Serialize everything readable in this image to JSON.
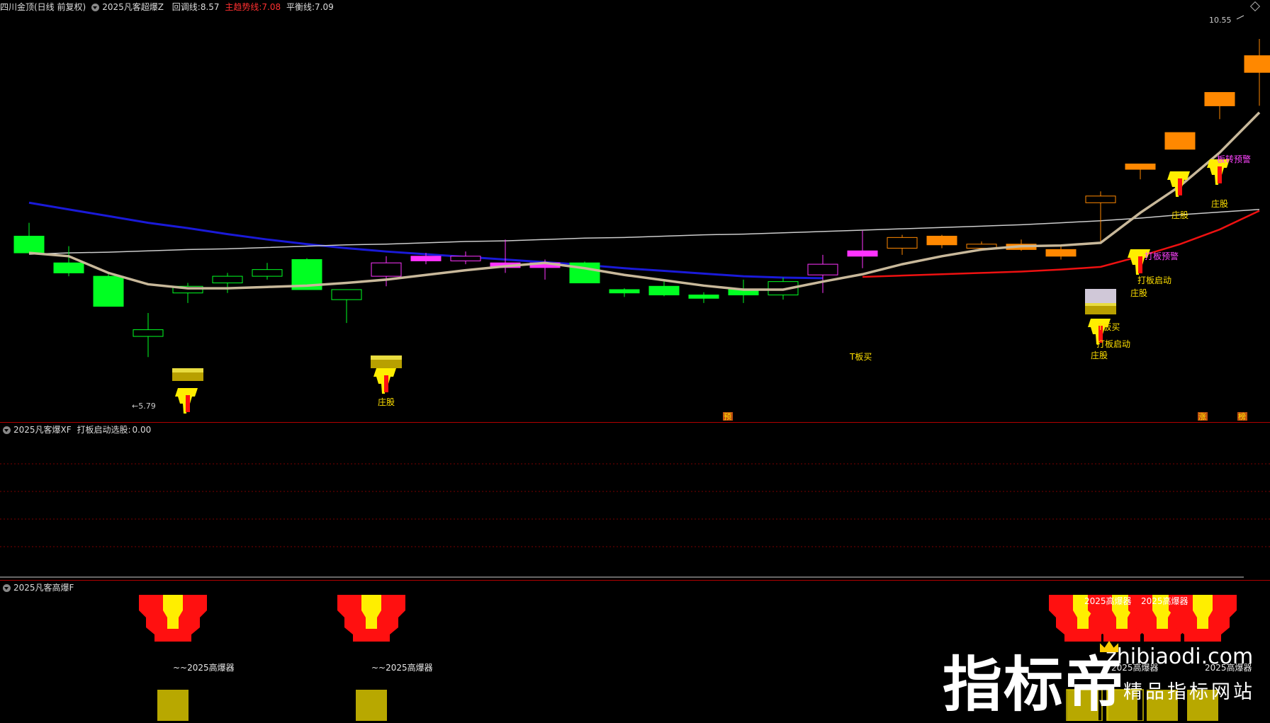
{
  "header": {
    "stock": "四川金顶(日线 前复权)",
    "indicator": "2025凡客超爆Z",
    "pullback_label": "回调线:",
    "pullback_value": "8.57",
    "trend_label": "主趋势线:",
    "trend_value": "7.08",
    "balance_label": "平衡线:",
    "balance_value": "7.09"
  },
  "colors": {
    "up": "#ff8800",
    "down": "#00ff22",
    "magenta": "#ff33ff",
    "trend": "#ee1111",
    "balance": "#cccccc",
    "pullback": "#c8b89a",
    "long_ma": "#1a1ad8",
    "separator": "#b00000"
  },
  "chart_data": [
    {
      "type": "candlestick",
      "title": "四川金顶(日线 前复权)",
      "price_range": [
        5.2,
        10.9
      ],
      "high_label": "10.55",
      "low_label": "5.79",
      "candles": [
        {
          "o": 7.6,
          "h": 7.8,
          "l": 7.4,
          "c": 7.35,
          "color": "green"
        },
        {
          "o": 7.2,
          "h": 7.45,
          "l": 7.0,
          "c": 7.05,
          "color": "green"
        },
        {
          "o": 7.0,
          "h": 7.05,
          "l": 6.55,
          "c": 6.55,
          "color": "green"
        },
        {
          "o": 6.2,
          "h": 6.45,
          "l": 5.79,
          "c": 6.1,
          "color": "green-hollow"
        },
        {
          "o": 6.85,
          "h": 6.9,
          "l": 6.6,
          "c": 6.75,
          "color": "green-hollow"
        },
        {
          "o": 7.0,
          "h": 7.05,
          "l": 6.75,
          "c": 6.9,
          "color": "green-hollow"
        },
        {
          "o": 7.1,
          "h": 7.2,
          "l": 6.95,
          "c": 7.0,
          "color": "green-hollow"
        },
        {
          "o": 7.25,
          "h": 7.27,
          "l": 6.8,
          "c": 6.8,
          "color": "green"
        },
        {
          "o": 6.65,
          "h": 6.8,
          "l": 6.3,
          "c": 6.8,
          "color": "green-hollow"
        },
        {
          "o": 7.2,
          "h": 7.3,
          "l": 6.85,
          "c": 7.0,
          "color": "magenta-hollow"
        },
        {
          "o": 7.3,
          "h": 7.35,
          "l": 7.18,
          "c": 7.23,
          "color": "magenta"
        },
        {
          "o": 7.3,
          "h": 7.37,
          "l": 7.18,
          "c": 7.23,
          "color": "magenta-hollow"
        },
        {
          "o": 7.2,
          "h": 7.55,
          "l": 7.05,
          "c": 7.13,
          "color": "magenta"
        },
        {
          "o": 7.2,
          "h": 7.25,
          "l": 6.95,
          "c": 7.13,
          "color": "magenta"
        },
        {
          "o": 7.2,
          "h": 7.22,
          "l": 6.9,
          "c": 6.9,
          "color": "green"
        },
        {
          "o": 6.8,
          "h": 6.82,
          "l": 6.69,
          "c": 6.75,
          "color": "green"
        },
        {
          "o": 6.85,
          "h": 6.95,
          "l": 6.7,
          "c": 6.72,
          "color": "green"
        },
        {
          "o": 6.72,
          "h": 6.76,
          "l": 6.6,
          "c": 6.67,
          "color": "green"
        },
        {
          "o": 6.8,
          "h": 6.95,
          "l": 6.6,
          "c": 6.72,
          "color": "green"
        },
        {
          "o": 6.72,
          "h": 6.98,
          "l": 6.65,
          "c": 6.92,
          "color": "green-hollow"
        },
        {
          "o": 7.02,
          "h": 7.32,
          "l": 6.75,
          "c": 7.18,
          "color": "magenta-hollow"
        },
        {
          "o": 7.3,
          "h": 7.68,
          "l": 7.12,
          "c": 7.38,
          "color": "magenta"
        },
        {
          "o": 7.42,
          "h": 7.62,
          "l": 7.32,
          "c": 7.58,
          "color": "orange-hollow"
        },
        {
          "o": 7.47,
          "h": 7.62,
          "l": 7.42,
          "c": 7.6,
          "color": "orange"
        },
        {
          "o": 7.42,
          "h": 7.52,
          "l": 7.38,
          "c": 7.48,
          "color": "orange-hollow"
        },
        {
          "o": 7.4,
          "h": 7.55,
          "l": 7.38,
          "c": 7.48,
          "color": "orange"
        },
        {
          "o": 7.3,
          "h": 7.45,
          "l": 7.25,
          "c": 7.4,
          "color": "orange"
        },
        {
          "o": 8.1,
          "h": 8.27,
          "l": 7.5,
          "c": 8.2,
          "color": "orange-hollow"
        },
        {
          "o": 8.6,
          "h": 8.68,
          "l": 8.45,
          "c": 8.68,
          "color": "orange"
        },
        {
          "o": 8.9,
          "h": 9.15,
          "l": 8.9,
          "c": 9.15,
          "color": "orange"
        },
        {
          "o": 9.55,
          "h": 9.75,
          "l": 9.35,
          "c": 9.75,
          "color": "orange"
        },
        {
          "o": 10.05,
          "h": 10.55,
          "l": 9.55,
          "c": 10.3,
          "color": "orange"
        }
      ],
      "series": [
        {
          "name": "回调线",
          "values": [
            7.35,
            7.3,
            7.05,
            6.88,
            6.82,
            6.82,
            6.84,
            6.86,
            6.9,
            6.95,
            7.02,
            7.09,
            7.15,
            7.2,
            7.12,
            7.02,
            6.94,
            6.86,
            6.8,
            6.8,
            6.92,
            7.03,
            7.18,
            7.3,
            7.4,
            7.45,
            7.46,
            7.5,
            7.95,
            8.35,
            8.85,
            9.45
          ]
        },
        {
          "name": "主趋势线",
          "values": [
            null,
            null,
            null,
            null,
            null,
            null,
            null,
            null,
            null,
            null,
            null,
            null,
            null,
            null,
            null,
            null,
            null,
            null,
            null,
            null,
            null,
            6.99,
            7.01,
            7.03,
            7.05,
            7.07,
            7.1,
            7.14,
            7.3,
            7.48,
            7.7,
            7.98
          ]
        },
        {
          "name": "平衡线",
          "values": [
            7.33,
            7.35,
            7.36,
            7.38,
            7.4,
            7.41,
            7.43,
            7.45,
            7.47,
            7.48,
            7.5,
            7.52,
            7.53,
            7.55,
            7.57,
            7.58,
            7.6,
            7.62,
            7.63,
            7.65,
            7.67,
            7.69,
            7.71,
            7.73,
            7.75,
            7.77,
            7.8,
            7.83,
            7.87,
            7.92,
            7.96,
            8.0
          ]
        },
        {
          "name": "long_ma",
          "values": [
            8.1,
            8.0,
            7.9,
            7.8,
            7.72,
            7.63,
            7.55,
            7.48,
            7.42,
            7.37,
            7.33,
            7.29,
            7.25,
            7.21,
            7.17,
            7.12,
            7.08,
            7.04,
            7.0,
            6.98,
            6.97,
            null,
            null,
            null,
            null,
            null,
            null,
            null,
            null,
            null,
            null,
            null
          ]
        }
      ],
      "annotations": [
        {
          "label": "庄股",
          "i": 9
        },
        {
          "label": "庄股",
          "i": 27
        },
        {
          "label": "庄股",
          "i": 28
        },
        {
          "label": "庄股",
          "i": 29
        },
        {
          "label": "庄股",
          "i": 30
        },
        {
          "label": "打板启动",
          "i": 27
        },
        {
          "label": "打板启动",
          "i": 28
        },
        {
          "label": "T板买",
          "i": 21
        },
        {
          "label": "T板买",
          "i": 27
        },
        {
          "label": "打板预警",
          "i": 28
        },
        {
          "label": "板转预警",
          "i": 30
        }
      ],
      "bottom_markers": [
        "预",
        "涨",
        "榜"
      ]
    },
    {
      "type": "line",
      "title": "2025凡客爆XF",
      "series_label": "打板启动选股:",
      "value": "0.00"
    },
    {
      "type": "bar",
      "title": "2025凡客高爆F",
      "labels": [
        "~~2025高爆器",
        "~~2025高爆器",
        "2025高爆器",
        "2025高爆器",
        "2025高爆器",
        "2025高爆器"
      ]
    }
  ],
  "watermark": {
    "cn": "指标帝",
    "url": "zhibiaodi.com",
    "tagline": "精品指标网站"
  }
}
